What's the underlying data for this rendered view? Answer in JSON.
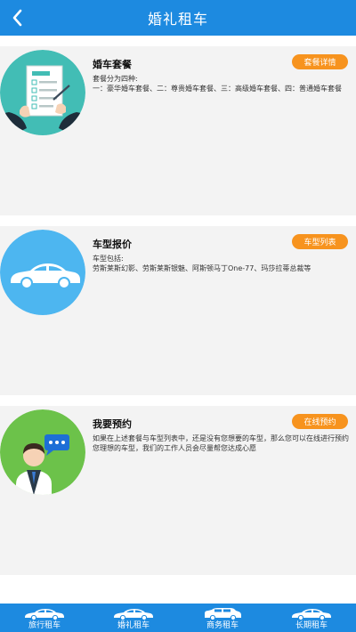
{
  "header": {
    "title": "婚礼租车",
    "back_icon": "chevron-left-icon"
  },
  "cards": [
    {
      "icon": "wedding-package-checklist-icon",
      "title": "婚车套餐",
      "button_label": "套餐详情",
      "description": "套餐分为四种:\n一：豪华婚车套餐、二：尊贵婚车套餐、三：高级婚车套餐、四：普通婚车套餐"
    },
    {
      "icon": "sedan-car-icon",
      "title": "车型报价",
      "button_label": "车型列表",
      "description": "车型包括:\n劳斯莱斯幻影、劳斯莱斯银魅、阿斯顿马丁One-77、玛莎拉蒂总裁等"
    },
    {
      "icon": "customer-service-chat-icon",
      "title": "我要预约",
      "button_label": "在线预约",
      "description": "如果在上述套餐与车型列表中，还是没有您想要的车型，那么您可以在线进行预约您理想的车型，我们的工作人员会尽量帮您达成心愿"
    }
  ],
  "tabbar": {
    "items": [
      {
        "label": "旅行租车",
        "icon": "car-icon"
      },
      {
        "label": "婚礼租车",
        "icon": "car-icon"
      },
      {
        "label": "商务租车",
        "icon": "car-icon"
      },
      {
        "label": "长期租车",
        "icon": "car-icon"
      }
    ]
  },
  "colors": {
    "primary": "#1d8ae0",
    "accent_button": "#f7931e",
    "card_background": "#f3f3f3",
    "circle_teal": "#42bdb5",
    "circle_blue": "#4db6f0",
    "circle_green": "#6cc24a"
  }
}
